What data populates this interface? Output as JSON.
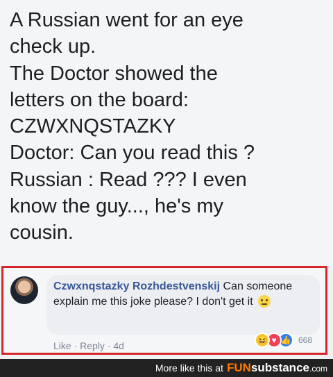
{
  "post": {
    "lines": [
      "A Russian went for an eye",
      "check up.",
      "The Doctor showed the",
      "letters on the board:",
      "CZWXNQSTAZKY",
      "Doctor: Can you read this ?",
      "Russian : Read ??? I even",
      "know the guy..., he's my",
      "cousin."
    ]
  },
  "comment": {
    "author": "Czwxnqstazky Rozhdestvenskij",
    "text": "Can someone explain me this joke please? I don't get it",
    "actions": {
      "like": "Like",
      "reply": "Reply",
      "separator": "·",
      "time": "4d"
    },
    "reactions": {
      "count": "668",
      "types": [
        "haha-icon",
        "love-icon",
        "like-icon"
      ]
    }
  },
  "footer": {
    "text": "More like this at",
    "brand_fun": "FUN",
    "brand_rest": "substance",
    "brand_dot": ".com"
  },
  "colors": {
    "highlight_border": "#d6252b",
    "author": "#385898",
    "brand_accent": "#ff7a00"
  }
}
